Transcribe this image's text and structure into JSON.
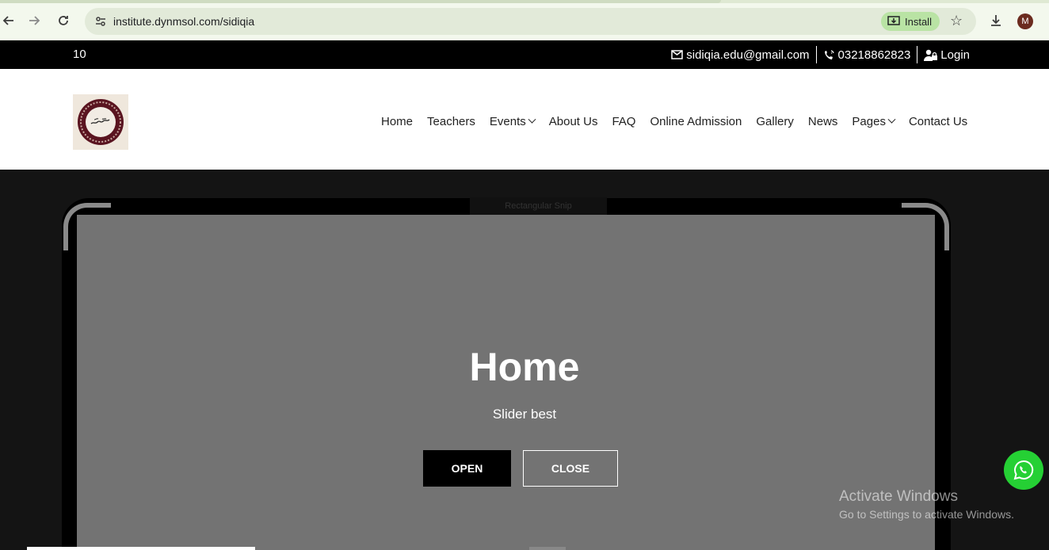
{
  "browser": {
    "url": "institute.dynmsol.com/sidiqia",
    "install_label": "Install",
    "avatar_initial": "M"
  },
  "topbar": {
    "left_text": "10",
    "email": "sidiqia.edu@gmail.com",
    "phone": "03218862823",
    "login": "Login"
  },
  "nav": {
    "items": [
      "Home",
      "Teachers",
      "Events",
      "About Us",
      "FAQ",
      "Online Admission",
      "Gallery",
      "News",
      "Pages",
      "Contact Us"
    ]
  },
  "hero": {
    "notch_label": "Rectangular Snip",
    "title": "Home",
    "subtitle": "Slider best",
    "open_label": "OPEN",
    "close_label": "CLOSE"
  },
  "watermark": {
    "line1": "Activate Windows",
    "line2": "Go to Settings to activate Windows."
  },
  "colors": {
    "topbar_bg": "#000000",
    "hero_screen": "#737373",
    "whatsapp": "#25d034"
  }
}
